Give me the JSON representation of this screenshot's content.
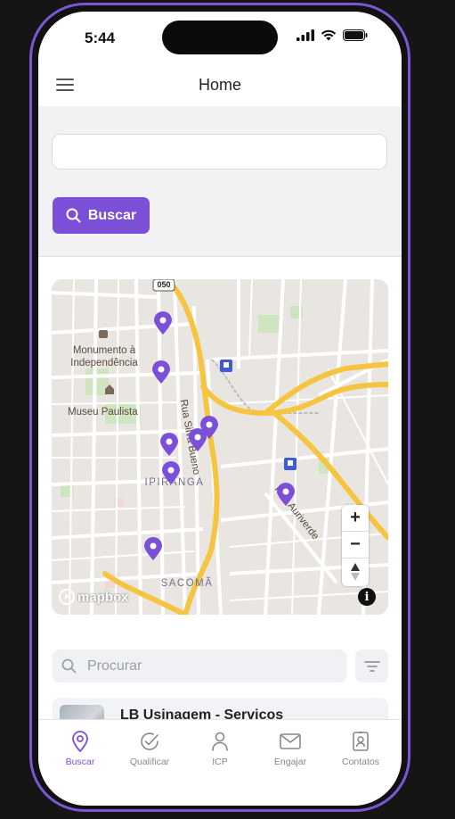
{
  "status_bar": {
    "time": "5:44"
  },
  "header": {
    "title": "Home"
  },
  "search": {
    "value": "",
    "button_label": "Buscar"
  },
  "map": {
    "labels": {
      "road_shield": "050",
      "monumento": "Monumento à Independência",
      "museu": "Museu Paulista",
      "silva_bueno": "Rua Silva Bueno",
      "ipiranga": "IPIRANGA",
      "auriverde": "Rua Auriverde",
      "sacoma": "SACOMÃ"
    },
    "zoom_in": "+",
    "zoom_out": "−",
    "info": "i",
    "attribution": "mapbox",
    "marker_color": "#7c4fd9"
  },
  "list": {
    "search_placeholder": "Procurar",
    "items": [
      {
        "title": "LB Usinagem - Serviços"
      }
    ]
  },
  "tabbar": {
    "tabs": [
      {
        "label": "Buscar",
        "icon": "map-pin-icon",
        "active": true
      },
      {
        "label": "Qualificar",
        "icon": "check-circle-icon",
        "active": false
      },
      {
        "label": "ICP",
        "icon": "user-icon",
        "active": false
      },
      {
        "label": "Engajar",
        "icon": "mail-icon",
        "active": false
      },
      {
        "label": "Contatos",
        "icon": "contact-card-icon",
        "active": false
      }
    ],
    "active_color": "#7c4fd9"
  }
}
